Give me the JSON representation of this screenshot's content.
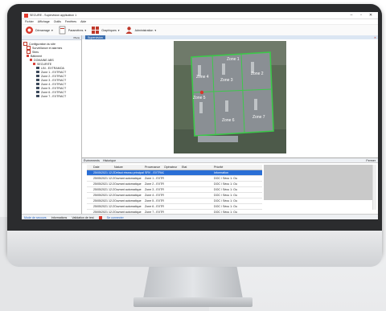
{
  "window": {
    "title": "SECURE - Supervision application 1",
    "min": "–",
    "max": "▫",
    "close": "✕"
  },
  "menu": [
    "Fichier",
    "Affichage",
    "Outils",
    "Fenêtres",
    "Aide"
  ],
  "toolbar": {
    "items": [
      {
        "label": "Démarrage",
        "color": "#d9372b"
      },
      {
        "label": "Paramètres",
        "color": "#e8eef6"
      },
      {
        "label": "Graphiques",
        "color": "#c0392b"
      },
      {
        "label": "Administration",
        "color": "#c0392b"
      }
    ]
  },
  "left_panel": {
    "header": "Plans",
    "tree": [
      {
        "label": "Configuration du site",
        "indent": 0,
        "kind": "tick"
      },
      {
        "label": "Surveillance et alarmes",
        "indent": 1,
        "kind": "tick"
      },
      {
        "label": "Sites",
        "indent": 1,
        "kind": "tick"
      },
      {
        "label": "Bâtiment",
        "indent": 1,
        "kind": "dot"
      },
      {
        "label": "DOMAINE ABS",
        "indent": 2,
        "kind": "dot"
      },
      {
        "label": "SECURITE",
        "indent": 3,
        "kind": "dot"
      },
      {
        "label": "LIN - EXTRAMOA",
        "indent": 4,
        "kind": "sq"
      },
      {
        "label": "Zone 1 - EXTRACT",
        "indent": 4,
        "kind": "sq"
      },
      {
        "label": "Zone 2 - EXTRACT",
        "indent": 4,
        "kind": "sq"
      },
      {
        "label": "Zone 3 - EXTRACT",
        "indent": 4,
        "kind": "sq"
      },
      {
        "label": "Zone 4 - EXTRACT",
        "indent": 4,
        "kind": "sq"
      },
      {
        "label": "Zone 5 - EXTRACT",
        "indent": 4,
        "kind": "sq"
      },
      {
        "label": "Zone 6 - EXTRACT",
        "indent": 4,
        "kind": "sq"
      },
      {
        "label": "Zone 7 - EXTRACT",
        "indent": 4,
        "kind": "sq"
      }
    ]
  },
  "map": {
    "tab": "Supervision",
    "zones": [
      "Zone 1",
      "Zone 2",
      "Zone 3",
      "Zone 4",
      "Zone 5",
      "Zone 6",
      "Zone 7"
    ]
  },
  "events": {
    "tabs": [
      "Événements",
      "Historique"
    ],
    "right_label": "Fermer",
    "columns": [
      "",
      "Date",
      "Nature",
      "Provenance",
      "Opérateur",
      "Etat",
      "Priorité"
    ],
    "rows": [
      {
        "cells": [
          "",
          "25/05/2021 12:28:25",
          "Défaut réseau principal",
          "SRV - EXTRACT",
          "",
          "",
          "Information"
        ],
        "selected": true
      },
      {
        "cells": [
          "",
          "25/05/2021 12:28:35",
          "Ouvrant automatique",
          "Zone 1 - EXTRACT",
          "",
          "",
          "DOC / Sécu 1: Ou"
        ],
        "selected": false
      },
      {
        "cells": [
          "",
          "25/05/2021 12:28:35",
          "Ouvrant automatique",
          "Zone 2 - EXTRACT",
          "",
          "",
          "DOC / Sécu 1: Ou"
        ],
        "selected": false
      },
      {
        "cells": [
          "",
          "25/05/2021 12:28:35",
          "Ouvrant automatique",
          "Zone 3 - EXTRACT",
          "",
          "",
          "DOC / Sécu 1: Ou"
        ],
        "selected": false
      },
      {
        "cells": [
          "",
          "25/05/2021 12:28:35",
          "Ouvrant automatique",
          "Zone 4 - EXTRACT",
          "",
          "",
          "DOC / Sécu 1: Ou"
        ],
        "selected": false
      },
      {
        "cells": [
          "",
          "25/05/2021 12:28:35",
          "Ouvrant automatique",
          "Zone 5 - EXTRACT",
          "",
          "",
          "DOC / Sécu 1: Ou"
        ],
        "selected": false
      },
      {
        "cells": [
          "",
          "25/05/2021 12:28:35",
          "Ouvrant automatique",
          "Zone 6 - EXTRACT",
          "",
          "",
          "DOC / Sécu 1: Ou"
        ],
        "selected": false
      },
      {
        "cells": [
          "",
          "25/05/2021 12:28:35",
          "Ouvrant automatique",
          "Zone 7 - EXTRACT",
          "",
          "",
          "DOC / Sécu 1: Ou"
        ],
        "selected": false
      }
    ]
  },
  "status": [
    "Mode de secours",
    "Informations",
    "Validation de test",
    "Se connecter"
  ],
  "colors": {
    "accent": "#2a6fd6",
    "zone_outline": "#3cc94a",
    "brand_red": "#d9372b"
  }
}
